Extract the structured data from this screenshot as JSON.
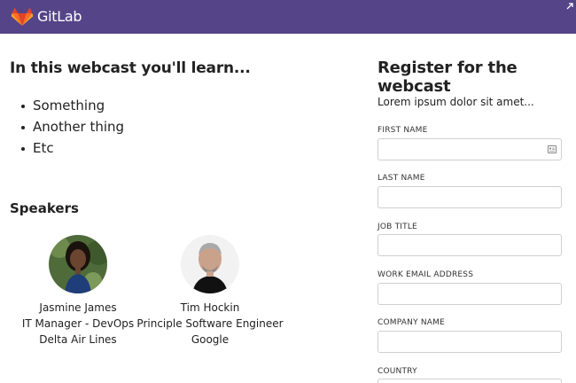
{
  "header": {
    "brand": "GitLab",
    "brand_color": "#554488"
  },
  "intro": {
    "heading": "In this webcast you'll learn...",
    "items": [
      "Something",
      "Another thing",
      "Etc"
    ]
  },
  "speakers": {
    "heading": "Speakers",
    "list": [
      {
        "name": "Jasmine James",
        "title": "IT Manager - DevOps",
        "company": "Delta Air Lines"
      },
      {
        "name": "Tim Hockin",
        "title": "Principle Software Engineer",
        "company": "Google"
      }
    ]
  },
  "form": {
    "title": "Register for the webcast",
    "intro": "Lorem ipsum dolor sit amet...",
    "fields": [
      {
        "label": "FIRST NAME",
        "value": ""
      },
      {
        "label": "LAST NAME",
        "value": ""
      },
      {
        "label": "JOB TITLE",
        "value": ""
      },
      {
        "label": "WORK EMAIL ADDRESS",
        "value": ""
      },
      {
        "label": "COMPANY NAME",
        "value": ""
      },
      {
        "label": "COUNTRY",
        "value": ""
      }
    ],
    "autofill_icon": "contact-card-icon"
  }
}
